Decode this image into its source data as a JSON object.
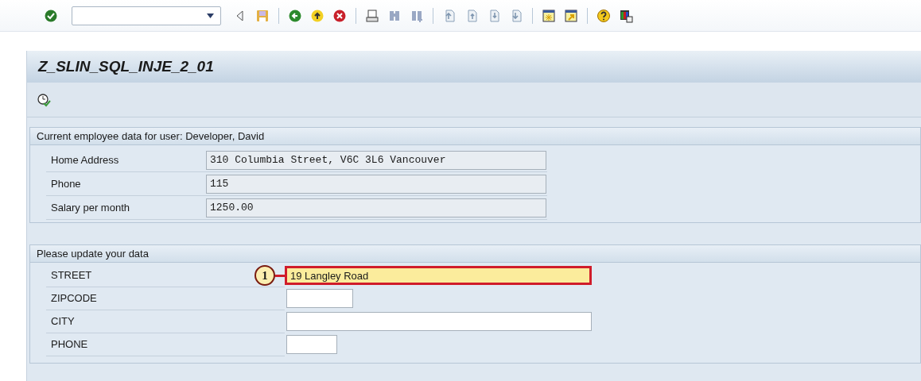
{
  "window": {
    "title": "Z_SLIN_SQL_INJE_2_01"
  },
  "employee_section": {
    "title": "Current employee data for user: Developer, David",
    "rows": [
      {
        "label": "Home Address",
        "value": "310 Columbia Street, V6C 3L6 Vancouver"
      },
      {
        "label": "Phone",
        "value": "115"
      },
      {
        "label": "Salary per month",
        "value": "1250.00"
      }
    ]
  },
  "update_section": {
    "title": "Please update your data",
    "fields": [
      {
        "label": "STREET",
        "value": "19 Langley Road",
        "highlighted": true,
        "callout": "1"
      },
      {
        "label": "ZIPCODE",
        "highlighted": false
      },
      {
        "label": "CITY",
        "highlighted": false
      },
      {
        "label": "PHONE",
        "highlighted": false
      }
    ]
  }
}
